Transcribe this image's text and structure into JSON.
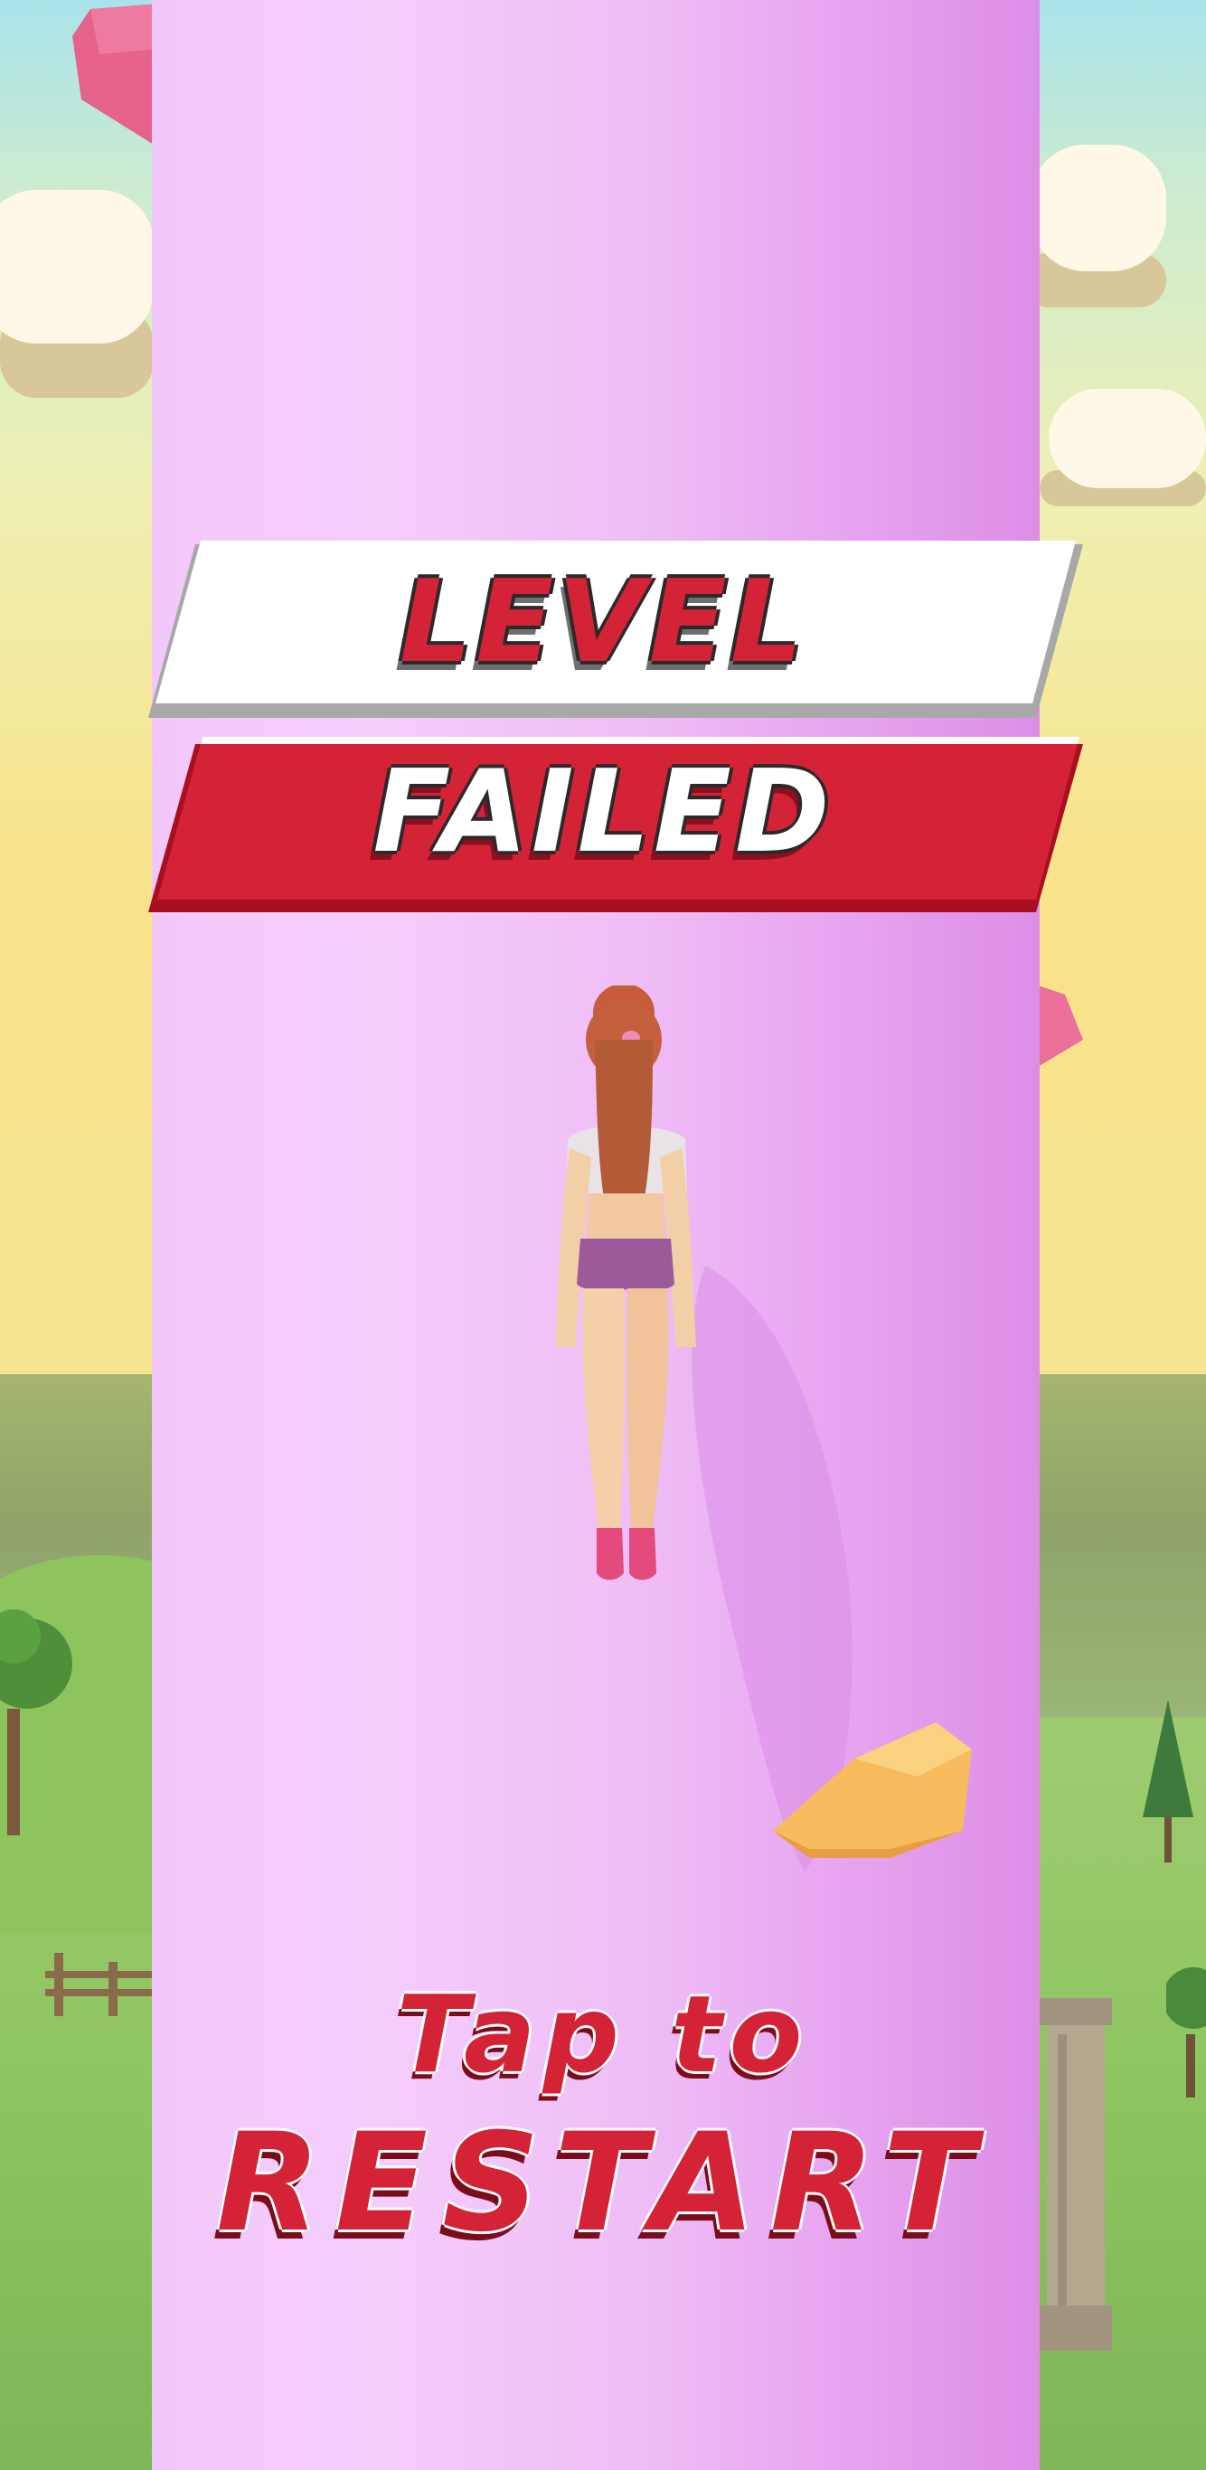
{
  "banner": {
    "line1": "LEVEL",
    "line2": "FAILED"
  },
  "restart": {
    "line1": "Tap to",
    "line2": "RESTART"
  },
  "colors": {
    "accent_red": "#d42236",
    "banner_white": "#ffffff",
    "pillar_pink": "#f2c8fa"
  }
}
